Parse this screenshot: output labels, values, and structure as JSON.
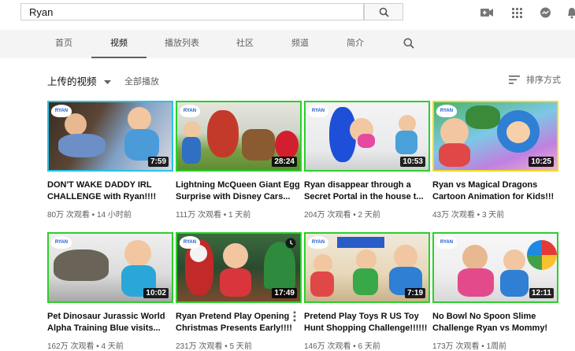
{
  "search": {
    "value": "Ryan"
  },
  "nav": {
    "tabs": [
      "首页",
      "视频",
      "播放列表",
      "社区",
      "频道",
      "简介"
    ],
    "active_index": 1
  },
  "section": {
    "title": "上传的视频",
    "play_all": "全部播放",
    "sort_label": "排序方式"
  },
  "videos": [
    {
      "title": "DON'T WAKE DADDY IRL CHALLENGE with Ryan!!!!",
      "meta": "80万 次观看 • 14 小时前",
      "duration": "7:59",
      "border": "#27c3e6"
    },
    {
      "title": "Lightning McQueen Giant Egg Surprise with Disney Cars...",
      "meta": "111万 次观看 • 1 天前",
      "duration": "28:24",
      "border": "#2ad02a"
    },
    {
      "title": "Ryan disappear through a Secret Portal in the house t...",
      "meta": "204万 次观看 • 2 天前",
      "duration": "10:53",
      "border": "#2ad02a"
    },
    {
      "title": "Ryan vs Magical Dragons Cartoon Animation for Kids!!!",
      "meta": "43万 次观看 • 3 天前",
      "duration": "10:25",
      "border": "#f0dc22"
    },
    {
      "title": "Pet Dinosaur Jurassic World Alpha Training Blue visits...",
      "meta": "162万 次观看 • 4 天前",
      "duration": "10:02",
      "border": "#2ad02a"
    },
    {
      "title": "Ryan Pretend Play Opening Christmas Presents Early!!!!",
      "meta": "231万 次观看 • 5 天前",
      "duration": "17:49",
      "border": "#2ad02a"
    },
    {
      "title": "Pretend Play Toys R US Toy Hunt Shopping Challenge!!!!!!",
      "meta": "146万 次观看 • 6 天前",
      "duration": "7:19",
      "border": "#2ad02a"
    },
    {
      "title": "No Bowl No Spoon Slime Challenge Ryan vs Mommy!",
      "meta": "173万 次观看 • 1周前",
      "duration": "12:11",
      "border": "#2ad02a"
    }
  ],
  "logo_text": "RYAN"
}
